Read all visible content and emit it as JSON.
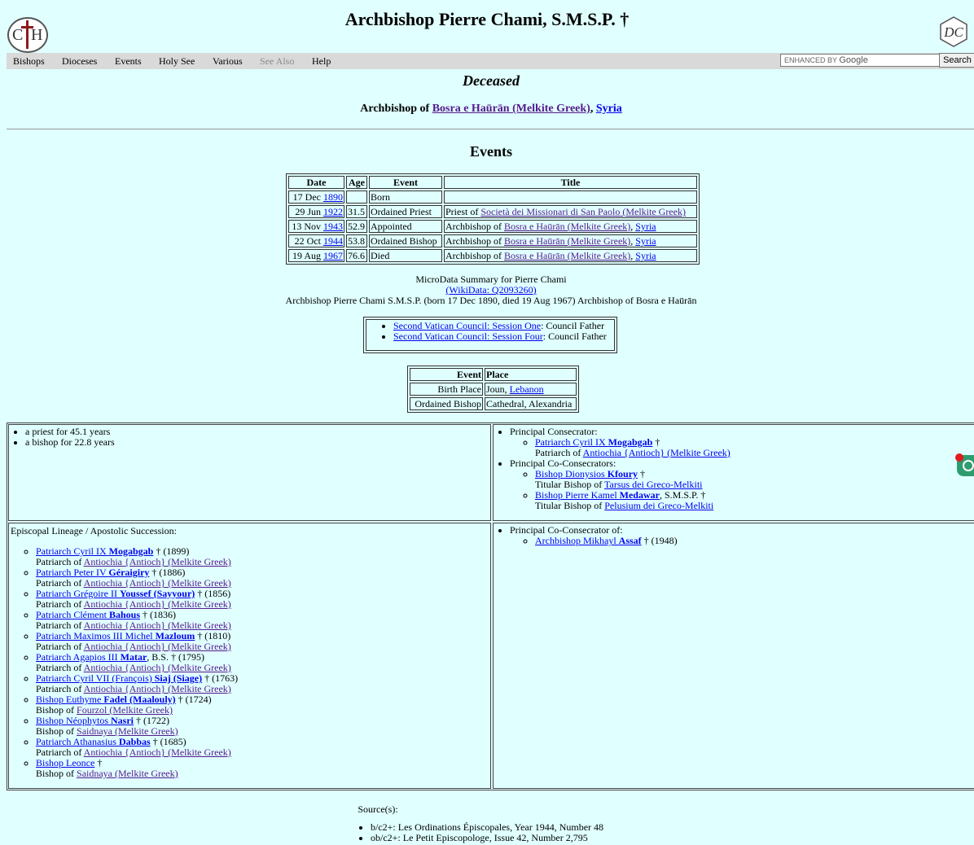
{
  "header": {
    "title": "Archbishop Pierre Chami, S.M.S.P. †",
    "left_logo": "CH",
    "right_logo": "DC"
  },
  "menu": {
    "items": [
      "Bishops",
      "Dioceses",
      "Events",
      "Holy See",
      "Various",
      "See Also",
      "Help"
    ],
    "search_placeholder_prefix": "ENHANCED BY",
    "search_placeholder_brand": "Google",
    "search_button": "Search"
  },
  "status": "Deceased",
  "subtitle": {
    "prefix": "Archbishop of ",
    "diocese": "Bosra e Haūrān (Melkite Greek)",
    "sep": ", ",
    "country": "Syria"
  },
  "events_heading": "Events",
  "events_table": {
    "headers": [
      "Date",
      "Age",
      "Event",
      "Title"
    ],
    "rows": [
      {
        "date": "17 Dec ",
        "year": "1890",
        "age": "",
        "event": "Born",
        "title_prefix": "",
        "title_link": "",
        "title_sep": "",
        "title_link2": ""
      },
      {
        "date": "29 Jun ",
        "year": "1922",
        "age": "31.5",
        "event": "Ordained Priest",
        "title_prefix": "Priest of ",
        "title_link": "Società dei Missionari di San Paolo (Melkite Greek)",
        "title_sep": "",
        "title_link2": ""
      },
      {
        "date": "13 Nov ",
        "year": "1943",
        "age": "52.9",
        "event": "Appointed",
        "title_prefix": "Archbishop of ",
        "title_link": "Bosra e Haūrān (Melkite Greek)",
        "title_sep": ", ",
        "title_link2": "Syria"
      },
      {
        "date": "22 Oct ",
        "year": "1944",
        "age": "53.8",
        "event": "Ordained Bishop",
        "title_prefix": "Archbishop of ",
        "title_link": "Bosra e Haūrān (Melkite Greek)",
        "title_sep": ", ",
        "title_link2": "Syria"
      },
      {
        "date": "19 Aug ",
        "year": "1967",
        "age": "76.6",
        "event": "Died",
        "title_prefix": "Archbishop of ",
        "title_link": "Bosra e Haūrān (Melkite Greek)",
        "title_sep": ", ",
        "title_link2": "Syria"
      }
    ]
  },
  "microdata": {
    "line1": "MicroData Summary for Pierre Chami",
    "wikidata": "(WikiData: Q2093260)",
    "line3": "Archbishop Pierre Chami S.M.S.P. (born 17 Dec 1890, died 19 Aug 1967) Archbishop of Bosra e Haūrān"
  },
  "councils": [
    {
      "link": "Second Vatican Council: Session One",
      "role": ": Council Father"
    },
    {
      "link": "Second Vatican Council: Session Four",
      "role": ": Council Father"
    }
  ],
  "places_table": {
    "headers": [
      "Event",
      "Place"
    ],
    "rows": [
      {
        "event": "Birth Place",
        "place": "Joun, ",
        "place_link": "Lebanon"
      },
      {
        "event": "Ordained Bishop",
        "place": "Cathedral, Alexandria",
        "place_link": ""
      }
    ]
  },
  "service": [
    "a priest for 45.1 years",
    "a bishop for 22.8 years"
  ],
  "consecration": {
    "principal_label": "Principal Consecrator:",
    "principal": {
      "name_pre": "Patriarch Cyril IX ",
      "name_bold": "Mogabgab",
      "suffix": " †",
      "title_pre": "Patriarch of ",
      "title_link": "Antiochia {Antioch} (Melkite Greek)"
    },
    "co_label": "Principal Co-Consecrators:",
    "co": [
      {
        "name_pre": "Bishop Dionysios ",
        "name_bold": "Kfoury",
        "suffix": " †",
        "title_pre": "Titular Bishop of ",
        "title_link": "Tarsus dei Greco-Melkiti"
      },
      {
        "name_pre": "Bishop Pierre Kamel ",
        "name_bold": "Medawar",
        "suffix": ", S.M.S.P. †",
        "title_pre": "Titular Bishop of ",
        "title_link": "Pelusium dei Greco-Melkiti"
      }
    ]
  },
  "lineage": {
    "title": "Episcopal Lineage / Apostolic Succession:",
    "items": [
      {
        "name_pre": "Patriarch Cyril IX ",
        "name_bold": "Mogabgab",
        "name_post": "",
        "suffix": " † (1899)",
        "title_pre": "Patriarch of ",
        "title_link": "Antiochia {Antioch} (Melkite Greek)"
      },
      {
        "name_pre": "Patriarch Peter IV ",
        "name_bold": "Géraigiry",
        "name_post": "",
        "suffix": " † (1886)",
        "title_pre": "Patriarch of ",
        "title_link": "Antiochia {Antioch} (Melkite Greek)"
      },
      {
        "name_pre": "Patriarch Grégoire II ",
        "name_bold": "Youssef (Sayyour)",
        "name_post": "",
        "suffix": " † (1856)",
        "title_pre": "Patriarch of ",
        "title_link": "Antiochia {Antioch} (Melkite Greek)"
      },
      {
        "name_pre": "Patriarch Clément ",
        "name_bold": "Bahous",
        "name_post": "",
        "suffix": " † (1836)",
        "title_pre": "Patriarch of ",
        "title_link": "Antiochia {Antioch} (Melkite Greek)"
      },
      {
        "name_pre": "Patriarch Maximos III Michel ",
        "name_bold": "Mazloum",
        "name_post": "",
        "suffix": " † (1810)",
        "title_pre": "Patriarch of ",
        "title_link": "Antiochia {Antioch} (Melkite Greek)"
      },
      {
        "name_pre": "Patriarch Agapios III ",
        "name_bold": "Matar",
        "name_post": "",
        "suffix": ", B.S. † (1795)",
        "title_pre": "Patriarch of ",
        "title_link": "Antiochia {Antioch} (Melkite Greek)"
      },
      {
        "name_pre": "Patriarch Cyril VII (François) ",
        "name_bold": "Siaj (Siage)",
        "name_post": "",
        "suffix": " † (1763)",
        "title_pre": "Patriarch of ",
        "title_link": "Antiochia {Antioch} (Melkite Greek)"
      },
      {
        "name_pre": "Bishop Euthyme ",
        "name_bold": "Fadel (Maalouly)",
        "name_post": "",
        "suffix": " † (1724)",
        "title_pre": "Bishop of ",
        "title_link": "Fourzol (Melkite Greek)"
      },
      {
        "name_pre": "Bishop Néophytos ",
        "name_bold": "Nasri",
        "name_post": "",
        "suffix": " † (1722)",
        "title_pre": "Bishop of ",
        "title_link": "Saidnaya (Melkite Greek)"
      },
      {
        "name_pre": "Patriarch Athanasius ",
        "name_bold": "Dabbas",
        "name_post": "",
        "suffix": " † (1685)",
        "title_pre": "Patriarch of ",
        "title_link": "Antiochia {Antioch} (Melkite Greek)"
      },
      {
        "name_pre": "Bishop Leonce",
        "name_bold": "",
        "name_post": "",
        "suffix": " †",
        "title_pre": "Bishop of ",
        "title_link": "Saidnaya (Melkite Greek)"
      }
    ]
  },
  "co_consecrator_of": {
    "label": "Principal Co-Consecrator of:",
    "items": [
      {
        "name_pre": "Archbishop Mikhayl ",
        "name_bold": "Assaf",
        "suffix": " † (1948)"
      }
    ]
  },
  "sources": {
    "heading": "Source(s):",
    "items": [
      "b/c2+: Les Ordinations Épiscopales, Year 1944, Number 48",
      "ob/c2+: Le Petit Episcopologe, Issue 42, Number 2,795"
    ]
  }
}
